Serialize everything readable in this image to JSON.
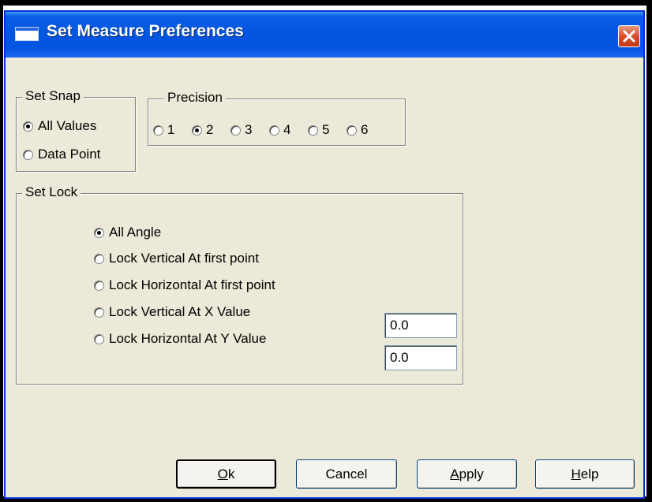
{
  "window": {
    "title": "Set Measure Preferences"
  },
  "snap": {
    "legend": "Set Snap",
    "options": [
      {
        "label": "All Values",
        "checked": true
      },
      {
        "label": "Data Point",
        "checked": false
      }
    ]
  },
  "precision": {
    "legend": "Precision",
    "options": [
      {
        "label": "1",
        "checked": false
      },
      {
        "label": "2",
        "checked": true
      },
      {
        "label": "3",
        "checked": false
      },
      {
        "label": "4",
        "checked": false
      },
      {
        "label": "5",
        "checked": false
      },
      {
        "label": "6",
        "checked": false
      }
    ]
  },
  "lock": {
    "legend": "Set Lock",
    "options": [
      {
        "label": "All Angle",
        "checked": true
      },
      {
        "label": "Lock Vertical At first point",
        "checked": false
      },
      {
        "label": "Lock Horizontal At first point",
        "checked": false
      },
      {
        "label": "Lock Vertical At X Value",
        "checked": false
      },
      {
        "label": "Lock Horizontal At Y Value",
        "checked": false
      }
    ],
    "x_value": "0.0",
    "y_value": "0.0"
  },
  "buttons": {
    "ok_mnemonic": "O",
    "ok_rest": "k",
    "cancel": "Cancel",
    "apply_mnemonic": "A",
    "apply_rest": "pply",
    "help_mnemonic": "H",
    "help_rest": "elp"
  },
  "icons": {
    "window_icon": "window-icon",
    "close_icon": "close-icon"
  }
}
